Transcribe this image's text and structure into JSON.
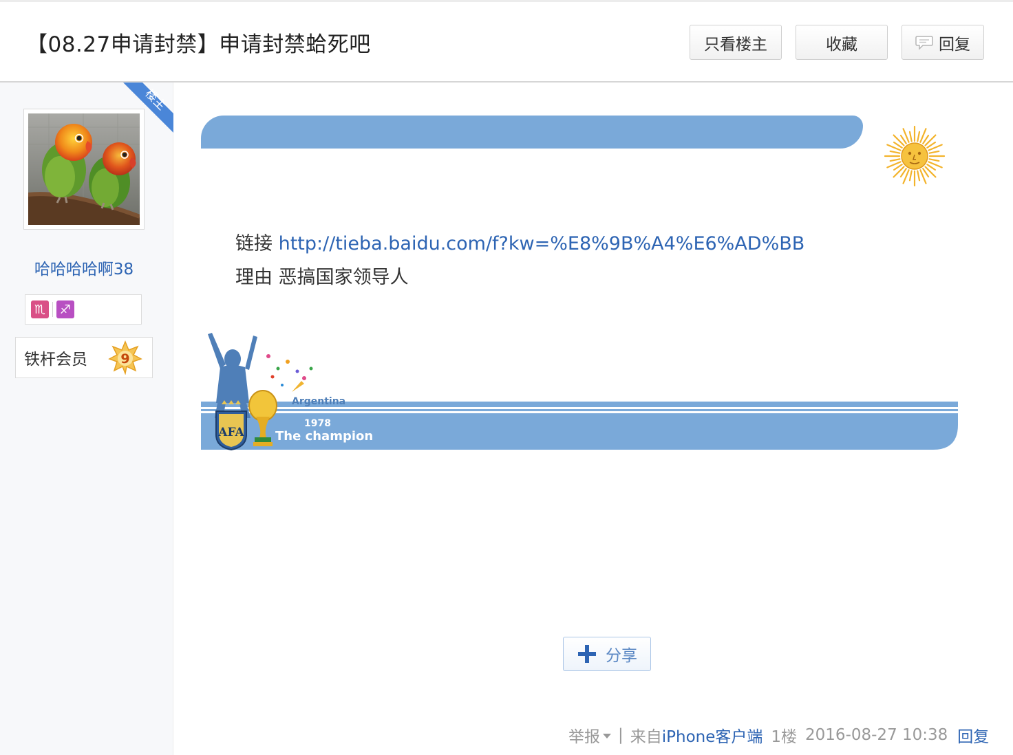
{
  "header": {
    "title": "【08.27申请封禁】申请封禁蛤死吧",
    "only_op_label": "只看楼主",
    "favorite_label": "收藏",
    "reply_label": "回复"
  },
  "author": {
    "op_badge": "楼主",
    "username": "哈哈哈哈啊38",
    "zodiac_icons": [
      "♏",
      "♐"
    ],
    "level_name": "铁杆会员",
    "level": "9"
  },
  "post": {
    "link_label": "链接",
    "link_url": "http://tieba.baidu.com/f?kw=%E8%9B%A4%E6%AD%BB",
    "reason_label": "理由",
    "reason_text": "恶搞国家领导人",
    "signature": {
      "title": "Argentina",
      "year": "1978",
      "caption": "The champion",
      "crest": "AFA"
    }
  },
  "share_label": "分享",
  "footer": {
    "report_label": "举报",
    "separator": "|",
    "from_prefix": "来自",
    "client": "iPhone客户端",
    "floor": "1楼",
    "time": "2016-08-27 10:38",
    "reply_label": "回复"
  },
  "colors": {
    "accent_blue": "#2d64b3",
    "banner_blue": "#7aa9d9",
    "op_ribbon": "#4a86d8",
    "sun_gold": "#f3b32b"
  }
}
